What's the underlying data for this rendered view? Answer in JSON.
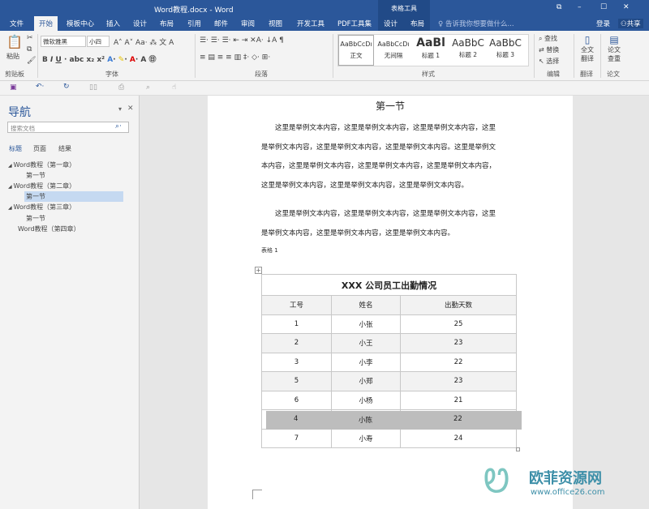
{
  "window": {
    "title": "Word教程.docx - Word",
    "context_tab": "表格工具",
    "controls": [
      "⧉",
      "–",
      "☐",
      "✕"
    ]
  },
  "tabs": [
    "文件",
    "开始",
    "模板中心",
    "插入",
    "设计",
    "布局",
    "引用",
    "邮件",
    "审阅",
    "视图",
    "开发工具",
    "PDF工具集",
    "设计",
    "布局"
  ],
  "tell_me": "告诉我你想要做什么...",
  "login": "登录",
  "share": "共享",
  "ribbon": {
    "font_name": "微软雅黑",
    "font_size": "小四",
    "groups": [
      "剪贴板",
      "字体",
      "段落",
      "样式",
      "编辑",
      "翻译",
      "论文"
    ],
    "paste": "粘贴",
    "styles": [
      {
        "preview": "AaBbCcDı",
        "name": "正文"
      },
      {
        "preview": "AaBbCcDı",
        "name": "无间隔"
      },
      {
        "preview": "AaBl",
        "name": "标题 1"
      },
      {
        "preview": "AaBbC",
        "name": "标题 2"
      },
      {
        "preview": "AaBbC",
        "name": "标题 3"
      }
    ],
    "edit": [
      "查找",
      "替换",
      "选择"
    ],
    "translate": "全文翻译",
    "paper": "论文查重"
  },
  "nav": {
    "title": "导航",
    "search_placeholder": "搜索文档",
    "tabs": [
      "标题",
      "页面",
      "结果"
    ],
    "items": [
      {
        "label": "Word教程（第一章）",
        "level": 1
      },
      {
        "label": "第一节",
        "level": 2
      },
      {
        "label": "Word教程（第二章）",
        "level": 1
      },
      {
        "label": "第一节",
        "level": 2,
        "selected": true
      },
      {
        "label": "Word教程（第三章）",
        "level": 1
      },
      {
        "label": "第一节",
        "level": 2
      },
      {
        "label": "Word教程（第四章）",
        "level": 1
      }
    ]
  },
  "doc": {
    "heading": "第一节",
    "para1": [
      "　　这里是举例文本内容，这里是举例文本内容，这里是举例文本内容，这里",
      "是举例文本内容，这里是举例文本内容，这里是举例文本内容。这里是举例文",
      "本内容，这里是举例文本内容，这里是举例文本内容，这里是举例文本内容，",
      "这里是举例文本内容，这里是举例文本内容，这里是举例文本内容。"
    ],
    "para2": [
      "　　这里是举例文本内容，这里是举例文本内容，这里是举例文本内容，这里",
      "是举例文本内容，这里是举例文本内容，这里是举例文本内容。"
    ],
    "caption": "表格 1",
    "table": {
      "title": "XXX 公司员工出勤情况",
      "headers": [
        "工号",
        "姓名",
        "出勤天数"
      ],
      "rows": [
        [
          "1",
          "小张",
          "25"
        ],
        [
          "2",
          "小王",
          "23"
        ],
        [
          "3",
          "小李",
          "22"
        ],
        [
          "5",
          "小郑",
          "23"
        ],
        [
          "6",
          "小杨",
          "21"
        ],
        [
          "4",
          "小陈",
          "22"
        ],
        [
          "7",
          "小寿",
          "24"
        ]
      ]
    }
  },
  "watermark": {
    "name": "欧菲资源网",
    "url": "www.office26.com"
  }
}
